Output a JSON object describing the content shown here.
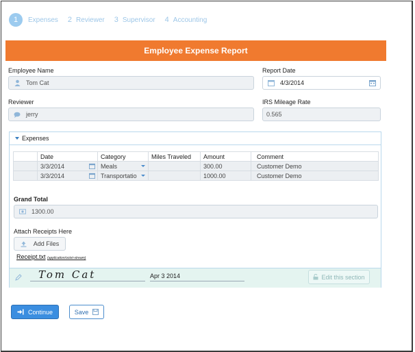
{
  "steps": [
    {
      "num": "1",
      "label": "Expenses",
      "active": true
    },
    {
      "num": "2",
      "label": "Reviewer",
      "active": false
    },
    {
      "num": "3",
      "label": "Supervisor",
      "active": false
    },
    {
      "num": "4",
      "label": "Accounting",
      "active": false
    }
  ],
  "header": {
    "title": "Employee Expense Report",
    "color": "#f07a2f"
  },
  "employee": {
    "label": "Employee Name",
    "value": "Tom Cat"
  },
  "report_date": {
    "label": "Report Date",
    "value": "4/3/2014"
  },
  "reviewer": {
    "label": "Reviewer",
    "value": "jerry"
  },
  "mileage": {
    "label": "IRS Mileage Rate",
    "value": "0.565"
  },
  "expenses": {
    "title": "Expenses",
    "columns": [
      "Date",
      "Category",
      "Miles Traveled",
      "Amount",
      "Comment"
    ],
    "rows": [
      {
        "date": "3/3/2014",
        "category": "Meals",
        "miles": "",
        "amount": "300.00",
        "comment": "Customer Demo"
      },
      {
        "date": "3/3/2014",
        "category": "Transportatio",
        "miles": "",
        "amount": "1000.00",
        "comment": "Customer Demo"
      }
    ]
  },
  "grand_total": {
    "label": "Grand Total",
    "value": "1300.00"
  },
  "attach": {
    "label": "Attach Receipts Here",
    "button": "Add Files",
    "file_name": "Receipt.txt",
    "file_type": "(application/octet-stream)"
  },
  "signature": {
    "text": "Tom Cat",
    "date": "Apr 3 2014",
    "edit_button": "Edit this section"
  },
  "actions": {
    "continue": "Continue",
    "save": "Save"
  },
  "colors": {
    "accent": "#2f86d6",
    "step": "#9ec7e8",
    "panel_border": "#b9d8ec",
    "sig_bg": "#e4f4f0"
  }
}
